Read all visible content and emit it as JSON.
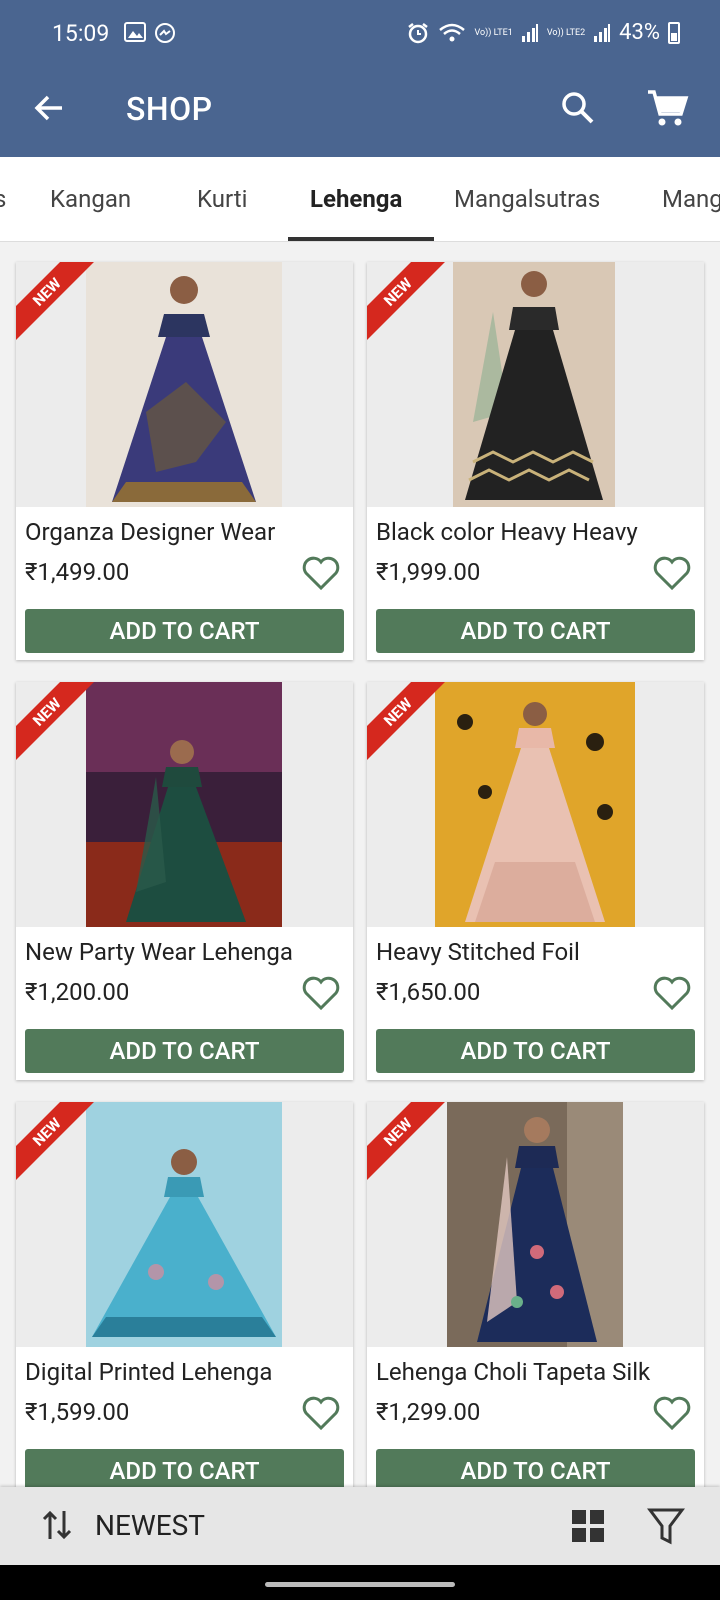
{
  "status_bar": {
    "time": "15:09",
    "battery": "43%",
    "sim1_label": "Vo)) LTE1",
    "sim2_label": "Vo)) LTE2",
    "icons": [
      "image-icon",
      "messenger-icon",
      "alarm-icon",
      "wifi-icon",
      "signal-icon",
      "signal-icon",
      "battery-icon"
    ]
  },
  "app_bar": {
    "title": "SHOP",
    "icons": [
      "back-arrow-icon",
      "search-icon",
      "cart-icon"
    ]
  },
  "tabs": [
    {
      "label": "s"
    },
    {
      "label": "Kangan"
    },
    {
      "label": "Kurti"
    },
    {
      "label": "Lehenga",
      "active": true
    },
    {
      "label": "Mangalsutras"
    },
    {
      "label": "Mang"
    }
  ],
  "products": [
    {
      "badge": "NEW",
      "name": "Organza Designer Wear",
      "price": "₹1,499.00",
      "button": "ADD TO CART"
    },
    {
      "badge": "NEW",
      "name": "Black color Heavy Heavy",
      "price": "₹1,999.00",
      "button": "ADD TO CART"
    },
    {
      "badge": "NEW",
      "name": "New Party Wear Lehenga",
      "price": "₹1,200.00",
      "button": "ADD TO CART"
    },
    {
      "badge": "NEW",
      "name": "Heavy Stitched Foil",
      "price": "₹1,650.00",
      "button": "ADD TO CART"
    },
    {
      "badge": "NEW",
      "name": "Digital Printed Lehenga",
      "price": "₹1,599.00",
      "button": "ADD TO CART"
    },
    {
      "badge": "NEW",
      "name": "Lehenga Choli Tapeta Silk",
      "price": "₹1,299.00",
      "button": "ADD TO CART"
    }
  ],
  "bottom_bar": {
    "sort_label": "NEWEST",
    "icons": [
      "sort-icon",
      "grid-view-icon",
      "filter-icon"
    ]
  },
  "colors": {
    "primary": "#4a6590",
    "add_button": "#527a5a",
    "badge": "#d5281e",
    "heart": "#527a5a"
  }
}
